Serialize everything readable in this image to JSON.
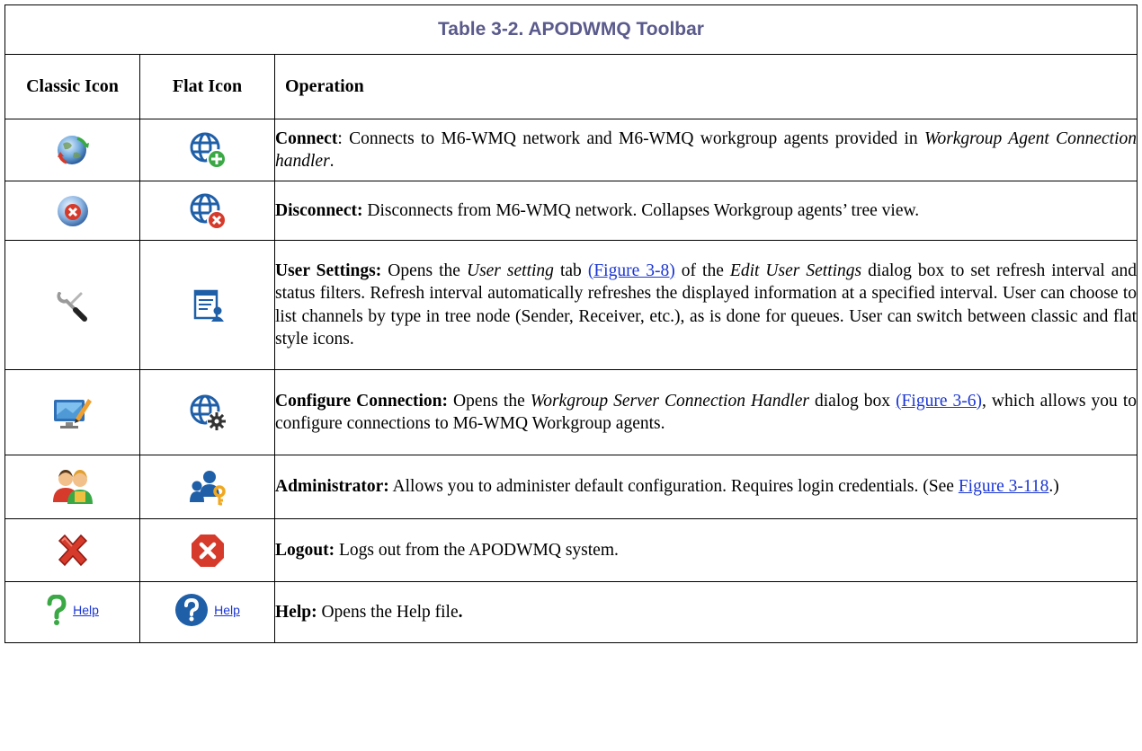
{
  "table": {
    "title": "Table 3-2. APODWMQ Toolbar",
    "headers": {
      "classic": "Classic Icon",
      "flat": "Flat Icon",
      "operation": "Operation"
    }
  },
  "rows": [
    {
      "classic_icon": "globe-refresh-icon",
      "flat_icon": "globe-plus-icon",
      "name": "Connect",
      "sep": ":",
      "t1": " Connects to M6-WMQ network and M6-WMQ workgroup agents provided in ",
      "i1": "Workgroup Agent Connection handler",
      "t2": "."
    },
    {
      "classic_icon": "globe-x-icon",
      "flat_icon": "globe-x-flat-icon",
      "name": "Disconnect:",
      "t1": "  Disconnects from M6-WMQ network.   Collapses Workgroup agents’ tree view."
    },
    {
      "classic_icon": "wrench-screwdriver-icon",
      "flat_icon": "user-settings-icon",
      "name": "User Settings:",
      "t1": " Opens the ",
      "i1": "User setting",
      "t2": " tab ",
      "link1": "(Figure 3-8)",
      "t3": " of the ",
      "i2": "Edit User Settings",
      "t4": " dialog box to set refresh interval and status filters.  Refresh interval automatically refreshes the displayed information at a specified interval.   User can choose to list channels by type in tree node (Sender, Receiver, etc.), as is done for queues.  User can switch between  classic and flat style icons."
    },
    {
      "classic_icon": "monitor-edit-icon",
      "flat_icon": "globe-gear-icon",
      "name": "Configure Connection:",
      "t1": " Opens the ",
      "i1": "Workgroup Server Connection Handler",
      "t2": " dialog box ",
      "link1": "(Figure 3-6)",
      "t3": ", which allows you to configure connections to M6-WMQ Workgroup agents."
    },
    {
      "classic_icon": "users-admin-icon",
      "flat_icon": "users-key-icon",
      "name": "Administrator:",
      "t1": "  Allows you to administer default configuration.    Requires login credentials.   (See ",
      "link1": "Figure 3-118",
      "t2": ".)"
    },
    {
      "classic_icon": "red-x-icon",
      "flat_icon": "red-circle-x-icon",
      "name": "Logout:",
      "t1": "  Logs out from the APODWMQ system."
    },
    {
      "classic_icon": "question-icon",
      "classic_label": "Help",
      "flat_icon": "question-circle-icon",
      "flat_label": "Help",
      "name": "Help:",
      "t1": "  Opens the Help file",
      "t2": "."
    }
  ],
  "colors": {
    "title": "#5a5a8c",
    "link": "#1a35d4",
    "red": "#d63a2b",
    "blue": "#1f5fa8",
    "green": "#3aa845"
  }
}
